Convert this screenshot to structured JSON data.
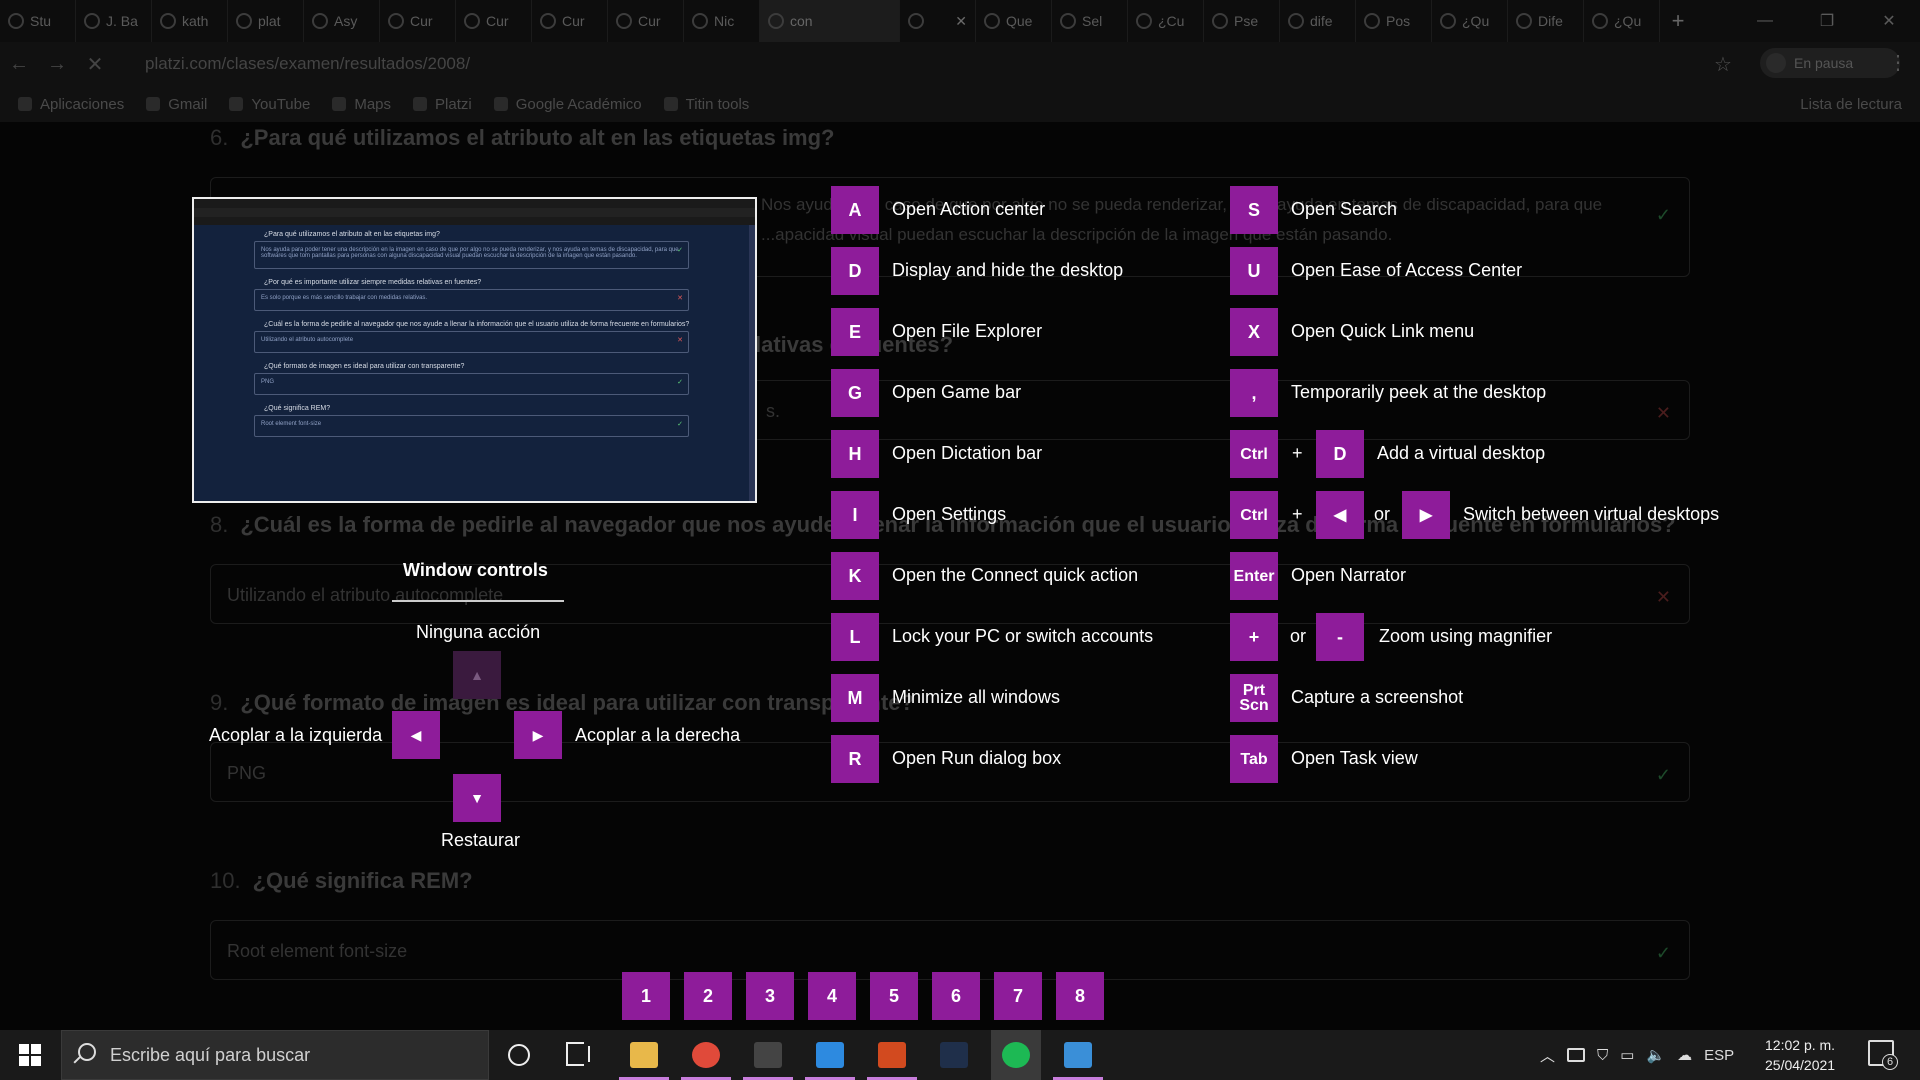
{
  "browser": {
    "tabs": [
      {
        "label": "Stu"
      },
      {
        "label": "J. Ba"
      },
      {
        "label": "kath"
      },
      {
        "label": "plat"
      },
      {
        "label": "Asy"
      },
      {
        "label": "Cur"
      },
      {
        "label": "Cur"
      },
      {
        "label": "Cur"
      },
      {
        "label": "Cur"
      },
      {
        "label": "Nic"
      },
      {
        "label": "con"
      },
      {
        "label": ""
      },
      {
        "label": "Que"
      },
      {
        "label": "Sel"
      },
      {
        "label": "¿Cu"
      },
      {
        "label": "Pse"
      },
      {
        "label": "dife"
      },
      {
        "label": "Pos"
      },
      {
        "label": "¿Qu"
      },
      {
        "label": "Dife"
      },
      {
        "label": "¿Qu"
      }
    ],
    "new_tab": "+",
    "tab_close": "✕",
    "url": "platzi.com/clases/examen/resultados/2008/",
    "profile_status": "En pausa",
    "bookmarks": [
      "Aplicaciones",
      "Gmail",
      "YouTube",
      "Maps",
      "Platzi",
      "Google Académico",
      "Titin tools"
    ],
    "reading_list": "Lista de lectura"
  },
  "page": {
    "questions": [
      {
        "num": "6.",
        "text": "¿Para qué utilizamos el atributo alt en las etiquetas img?",
        "answer": "Nos ayuda para poder tener una descripción en la imagen en caso de que por algo no se pueda renderizar, y nos ayuda en temas de discapacidad, para que softwares que tom pantallas para personas con alguna discapacidad visual puedan escuchar la descripción de la imagen que están pasando.",
        "answer_tail": "Nos ayuda... en caso de que por algo no se pueda renderizar, y nos ayuda en temas de discapacidad, para que",
        "answer_tail2": "...apacidad visual puedan escuchar la descripción de la imagen que están pasando.",
        "status": "correct"
      },
      {
        "num": "7.",
        "text": "¿Por qué es importante utilizar siempre medidas relativas en fuentes?",
        "answer": "Es solo porque es más sencillo trabajar con medidas relativas.",
        "status": "wrong"
      },
      {
        "num": "8.",
        "text": "¿Cuál es la forma de pedirle al navegador que nos ayude a llenar la información que el usuario utiliza de forma frecuente en formularios?",
        "answer": "Utilizando el atributo autocomplete",
        "status": "wrong"
      },
      {
        "num": "9.",
        "text": "¿Qué formato de imagen es ideal para utilizar con transparente?",
        "answer": "PNG",
        "status": "correct"
      },
      {
        "num": "10.",
        "text": "¿Qué significa REM?",
        "answer": "Root element font-size",
        "status": "correct"
      }
    ]
  },
  "overlay": {
    "window_controls": {
      "title": "Window controls",
      "up_label": "Ninguna acción",
      "left_label": "Acoplar a la izquierda",
      "right_label": "Acoplar a la derecha",
      "down_label": "Restaurar"
    },
    "shortcuts_left": [
      {
        "key": "A",
        "desc": "Open Action center"
      },
      {
        "key": "D",
        "desc": "Display and hide the desktop"
      },
      {
        "key": "E",
        "desc": "Open File Explorer"
      },
      {
        "key": "G",
        "desc": "Open Game bar"
      },
      {
        "key": "H",
        "desc": "Open Dictation bar"
      },
      {
        "key": "I",
        "desc": "Open Settings"
      },
      {
        "key": "K",
        "desc": "Open the Connect quick action"
      },
      {
        "key": "L",
        "desc": "Lock your PC or switch accounts"
      },
      {
        "key": "M",
        "desc": "Minimize all windows"
      },
      {
        "key": "R",
        "desc": "Open Run dialog box"
      }
    ],
    "shortcuts_right": {
      "s": {
        "key": "S",
        "desc": "Open Search"
      },
      "u": {
        "key": "U",
        "desc": "Open Ease of Access Center"
      },
      "x": {
        "key": "X",
        "desc": "Open Quick Link menu"
      },
      "comma": {
        "key": ",",
        "desc": "Temporarily peek at the desktop"
      },
      "vd_add": {
        "key1": "Ctrl",
        "plus": "+",
        "key2": "D",
        "desc": "Add a virtual desktop"
      },
      "vd_switch": {
        "key1": "Ctrl",
        "plus": "+",
        "left": "◀",
        "or": "or",
        "right": "▶",
        "desc": "Switch between virtual desktops"
      },
      "enter": {
        "key": "Enter",
        "desc": "Open Narrator"
      },
      "zoom": {
        "plus": "+",
        "or": "or",
        "minus": "-",
        "desc": "Zoom using magnifier"
      },
      "prtscn": {
        "key_line1": "Prt",
        "key_line2": "Scn",
        "desc": "Capture a screenshot"
      },
      "tab": {
        "key": "Tab",
        "desc": "Open Task view"
      }
    },
    "taskbar_numbers": [
      "1",
      "2",
      "3",
      "4",
      "5",
      "6",
      "7",
      "8"
    ],
    "accent_color": "#8e1c9a"
  },
  "taskbar": {
    "search_placeholder": "Escribe aquí para buscar",
    "apps": [
      {
        "name": "file-explorer",
        "color": "#e8b84a"
      },
      {
        "name": "chrome",
        "color": "#e04a3a"
      },
      {
        "name": "terminal",
        "color": "#444"
      },
      {
        "name": "vscode",
        "color": "#2d8ae0"
      },
      {
        "name": "office",
        "color": "#d24a1f"
      },
      {
        "name": "ide",
        "color": "#1f2f4a"
      },
      {
        "name": "spotify",
        "color": "#1db954"
      },
      {
        "name": "photos",
        "color": "#3a8fd8"
      }
    ],
    "language": "ESP",
    "time": "12:02 p. m.",
    "date": "25/04/2021",
    "notifications": "6"
  }
}
